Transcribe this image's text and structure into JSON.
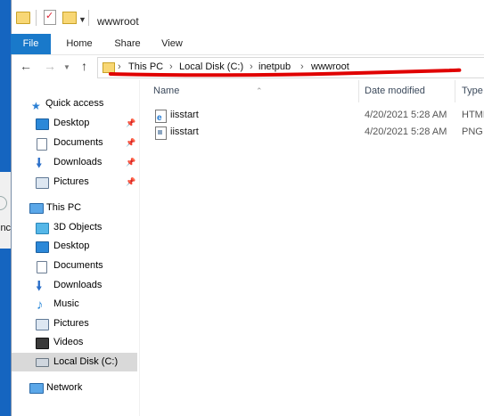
{
  "window": {
    "title": "wwwroot"
  },
  "ribbon": {
    "tabs": [
      "File",
      "Home",
      "Share",
      "View"
    ]
  },
  "address": {
    "crumbs": [
      "This PC",
      "Local Disk (C:)",
      "inetpub",
      "wwwroot"
    ]
  },
  "nav": {
    "items": [
      {
        "label": "Quick access",
        "icon": "star-icon"
      },
      {
        "label": "Desktop",
        "icon": "desktop-icon",
        "pinned": true
      },
      {
        "label": "Documents",
        "icon": "documents-icon",
        "pinned": true
      },
      {
        "label": "Downloads",
        "icon": "downloads-icon",
        "pinned": true
      },
      {
        "label": "Pictures",
        "icon": "pictures-icon",
        "pinned": true
      },
      {
        "label": "This PC",
        "icon": "computer-icon"
      },
      {
        "label": "3D Objects",
        "icon": "3d-objects-icon"
      },
      {
        "label": "Desktop",
        "icon": "desktop-icon"
      },
      {
        "label": "Documents",
        "icon": "documents-icon"
      },
      {
        "label": "Downloads",
        "icon": "downloads-icon"
      },
      {
        "label": "Music",
        "icon": "music-icon"
      },
      {
        "label": "Pictures",
        "icon": "pictures-icon"
      },
      {
        "label": "Videos",
        "icon": "videos-icon"
      },
      {
        "label": "Local Disk (C:)",
        "icon": "drive-icon",
        "selected": true
      },
      {
        "label": "Network",
        "icon": "network-icon"
      }
    ]
  },
  "columns": {
    "name": "Name",
    "date": "Date modified",
    "type": "Type"
  },
  "files": [
    {
      "name": "iisstart",
      "date": "4/20/2021 5:28 AM",
      "type": "HTML",
      "icon": "html-file-icon"
    },
    {
      "name": "iisstart",
      "date": "4/20/2021 5:28 AM",
      "type": "PNG",
      "icon": "png-file-icon"
    }
  ],
  "background_window": {
    "text": "inc"
  },
  "colors": {
    "accent": "#1979ca",
    "annotation": "#e00000",
    "desktop": "#1565c0"
  }
}
